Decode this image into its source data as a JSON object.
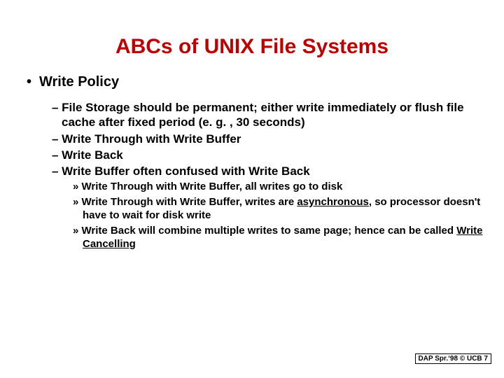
{
  "title": "ABCs of UNIX File Systems",
  "l1": {
    "bullet": "•",
    "text": "Write Policy"
  },
  "l2": {
    "a": "– File Storage should be permanent; either write immediately or flush file cache after fixed period (e. g. , 30 seconds)",
    "b": "– Write Through with Write Buffer",
    "c": "– Write Back",
    "d": "– Write Buffer often confused with Write Back"
  },
  "l3": {
    "a": "» Write Through with Write Buffer, all writes go to disk",
    "b_pre": "» Write Through with Write Buffer, writes are ",
    "b_us": "asynchronous",
    "b_post": ", so processor doesn't have to wait for disk write",
    "c_pre": "» Write Back will combine multiple writes to same page; hence can be called ",
    "c_us": "Write Cancelling"
  },
  "footer": "DAP Spr.‘98 © UCB 7"
}
